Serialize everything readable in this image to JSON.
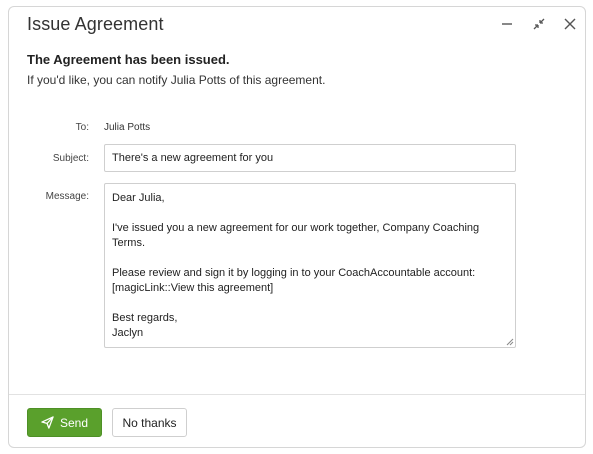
{
  "dialog": {
    "title": "Issue Agreement",
    "controls": {
      "minimize_icon": "minimize-icon",
      "shrink_icon": "collapse-arrows-icon",
      "close_icon": "close-icon"
    }
  },
  "notice": {
    "headline": "The Agreement has been issued.",
    "text": "If you'd like, you can notify Julia Potts of this agreement."
  },
  "form": {
    "to_label": "To:",
    "to_value": "Julia Potts",
    "subject_label": "Subject:",
    "subject_value": "There's a new agreement for you",
    "message_label": "Message:",
    "message_lines": [
      "Dear Julia,",
      "",
      "I've issued you a new agreement for our work together, Company Coaching",
      "Terms.",
      "",
      "Please review and sign it by logging in to your CoachAccountable account:",
      "[magicLink::View this agreement]",
      "",
      "Best regards,",
      "Jaclyn"
    ]
  },
  "actions": {
    "send_label": "Send",
    "send_icon": "paper-plane-icon",
    "no_thanks_label": "No thanks"
  },
  "colors": {
    "send_button": "#5aa02c",
    "border": "#d6d6d6"
  }
}
